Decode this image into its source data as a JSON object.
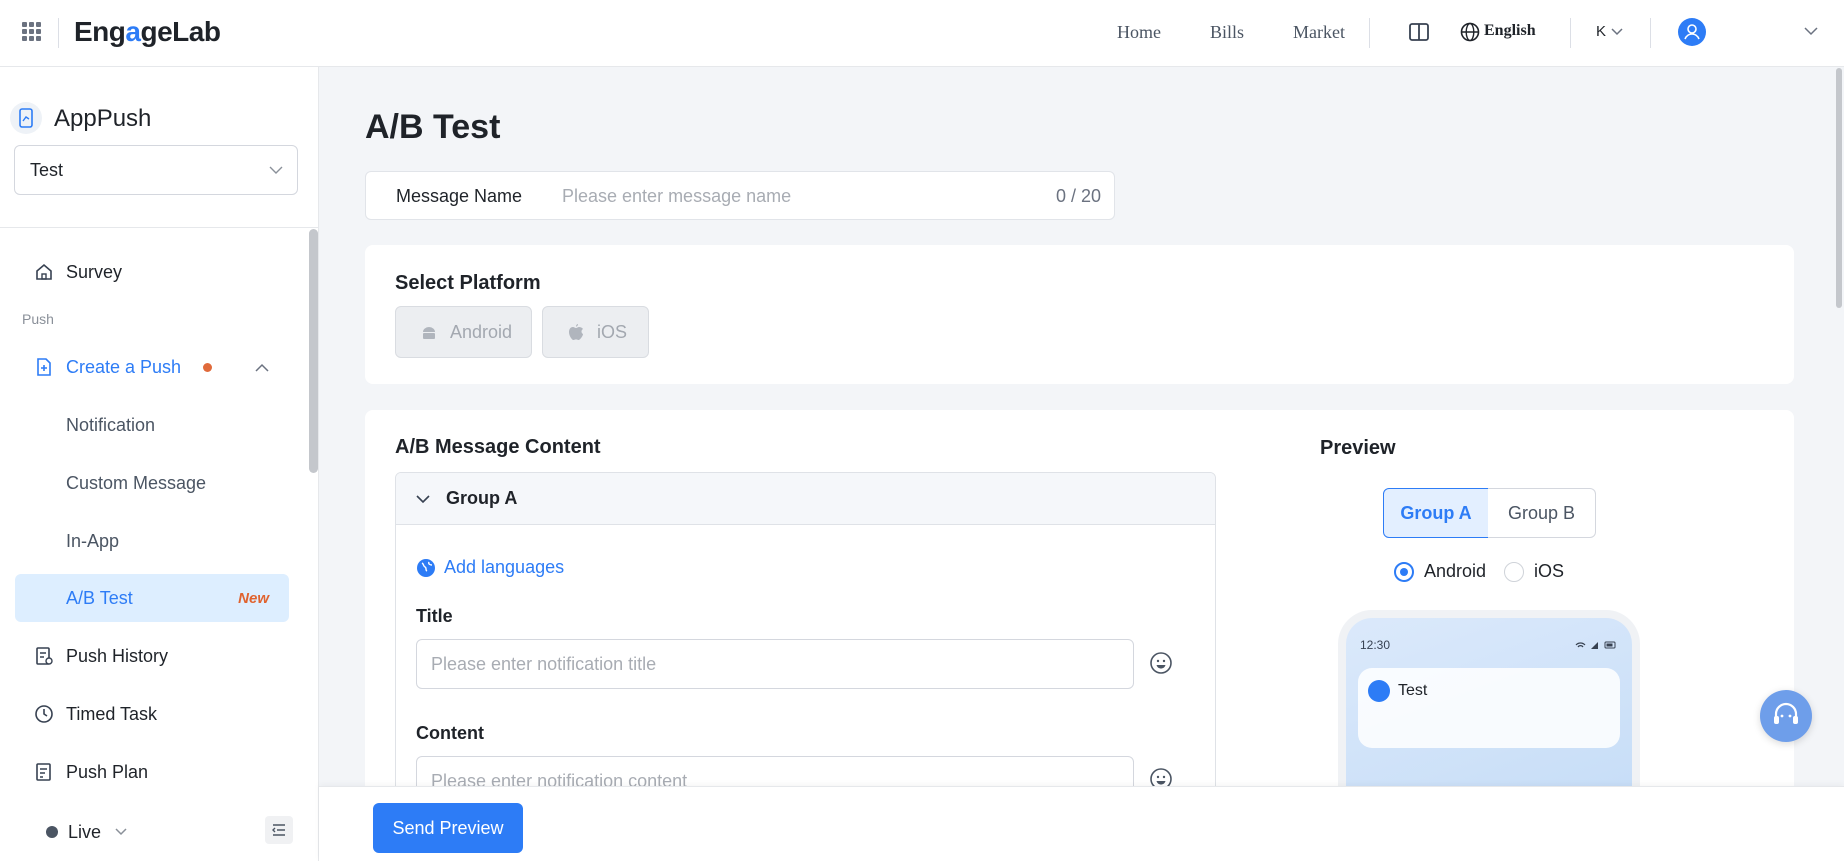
{
  "topbar": {
    "brand_pre": "Eng",
    "brand_o": "a",
    "brand_mid": "ge",
    "brand_post": "Lab",
    "nav": [
      "Home",
      "Bills",
      "Market"
    ],
    "language": "English",
    "account": "K"
  },
  "sidebar": {
    "app_name": "AppPush",
    "app_select": "Test",
    "section_push": "Push",
    "items": {
      "survey": "Survey",
      "create_push": "Create a Push",
      "notification": "Notification",
      "custom_message": "Custom Message",
      "in_app": "In-App",
      "ab_test": "A/B Test",
      "ab_test_badge": "New",
      "push_history": "Push History",
      "timed_task": "Timed Task",
      "push_plan": "Push Plan"
    },
    "environment": "Live"
  },
  "main": {
    "title": "A/B Test",
    "message_name": {
      "label": "Message Name",
      "placeholder": "Please enter message name",
      "counter": "0 / 20"
    },
    "platform": {
      "title": "Select Platform",
      "options": [
        "Android",
        "iOS"
      ]
    },
    "content": {
      "title": "A/B Message Content",
      "group": "Group A",
      "add_languages": "Add languages",
      "title_label": "Title",
      "title_placeholder": "Please enter notification title",
      "content_label": "Content",
      "content_placeholder": "Please enter notification content"
    },
    "preview": {
      "title": "Preview",
      "groups": [
        "Group A",
        "Group B"
      ],
      "selected_group": "Group A",
      "os": [
        "Android",
        "iOS"
      ],
      "selected_os": "Android",
      "phone_time": "12:30",
      "notification_title": "Test"
    },
    "send_preview": "Send Preview"
  },
  "colors": {
    "accent": "#2d7cf6",
    "badge": "#e0632f"
  }
}
